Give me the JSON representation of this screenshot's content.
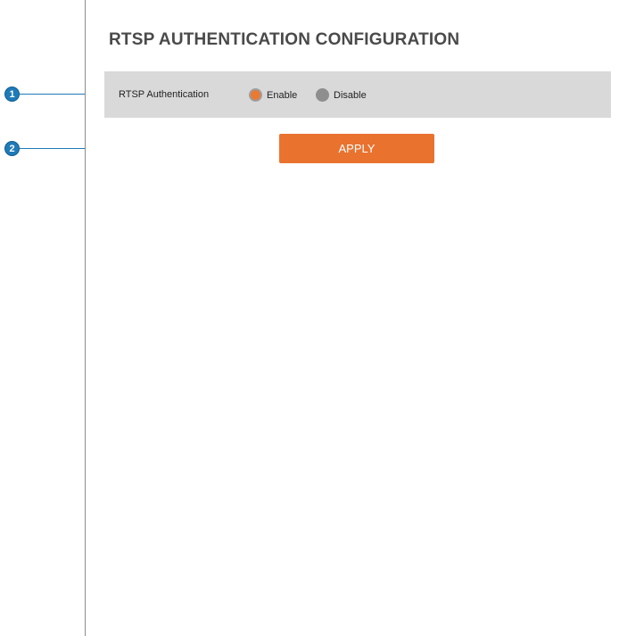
{
  "page": {
    "title": "RTSP AUTHENTICATION CONFIGURATION"
  },
  "rtsp": {
    "label": "RTSP Authentication",
    "options": [
      {
        "label": "Enable",
        "selected": true
      },
      {
        "label": "Disable",
        "selected": false
      }
    ]
  },
  "actions": {
    "apply_label": "APPLY"
  },
  "callouts": [
    {
      "number": "1"
    },
    {
      "number": "2"
    }
  ],
  "colors": {
    "accent": "#e9722f",
    "callout": "#1f7ab8",
    "row_bg": "#d9d9d9"
  }
}
